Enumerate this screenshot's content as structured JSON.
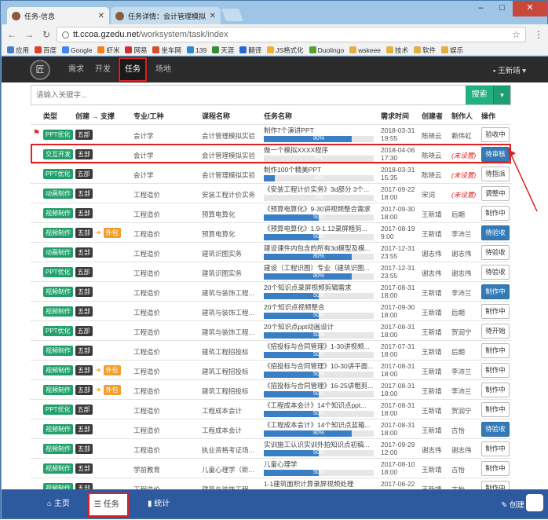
{
  "browser": {
    "tabs": [
      {
        "title": "任务-信息",
        "active": true
      },
      {
        "title": "任务详情：会计管理模拟...",
        "active": false
      }
    ],
    "url_host": "tt.ccoa.gzedu.net",
    "url_path": "/worksystem/task/index",
    "bookmarks": [
      "应用",
      "百度",
      "Google",
      "虾米",
      "网易",
      "坐车网",
      "139",
      "天涯",
      "翻译",
      "JS格式化",
      "Duolingo",
      "wskeee",
      "技术",
      "软件",
      "娱乐"
    ]
  },
  "appnav": {
    "logo_text": "匠",
    "items": [
      "需求",
      "开发",
      "任务",
      "场地"
    ],
    "active": "任务",
    "user": "王新靖"
  },
  "search": {
    "placeholder": "请输入关键字...",
    "button": "搜索"
  },
  "columns": {
    "type": "类型",
    "create_support": "创建 → 支撑",
    "major": "专业/工种",
    "course": "课程名称",
    "task": "任务名称",
    "time": "需求时间",
    "creator": "创建者",
    "maker": "制作人",
    "op": "操作"
  },
  "rows": [
    {
      "flag": true,
      "type": "PPT优化",
      "dept": "五部",
      "support": "",
      "major": "会计学",
      "course": "会计管理模拟实验",
      "task": "制作7个演讲PPT",
      "progress": "80%",
      "date": "2018-03-31",
      "time": "19:55",
      "creator": "陈晓云",
      "maker": "赖伟虹",
      "maker_unset": false,
      "op": "验收中",
      "op_primary": false
    },
    {
      "flag": false,
      "type": "交互开发",
      "dept": "五部",
      "support": "",
      "major": "会计学",
      "course": "会计管理模拟实验",
      "task": "做一个模拟XXXX程序",
      "progress": "0%",
      "date": "2018-04-06",
      "time": "17:30",
      "creator": "陈晓云",
      "maker": "(未设置)",
      "maker_unset": true,
      "op": "待审核",
      "op_primary": true,
      "highlight": true
    },
    {
      "flag": false,
      "type": "PPT优化",
      "dept": "五部",
      "support": "",
      "major": "会计学",
      "course": "会计管理模拟实验",
      "task": "制作100个精美PPT",
      "progress": "10%",
      "date": "2018-03-31",
      "time": "15:35",
      "creator": "陈晓云",
      "maker": "(未设置)",
      "maker_unset": true,
      "op": "待指派",
      "op_primary": false
    },
    {
      "flag": false,
      "type": "动画制作",
      "dept": "五部",
      "support": "",
      "major": "工程造价",
      "course": "安装工程计价实务",
      "task": "《安装工程计价实务》3d部分 3个...",
      "progress": "0%",
      "date": "2017-09-22",
      "time": "18:00",
      "creator": "宋词",
      "maker": "(未设置)",
      "maker_unset": true,
      "op": "调整中",
      "op_primary": false
    },
    {
      "flag": false,
      "type": "视频制作",
      "dept": "五部",
      "support": "",
      "major": "工程造价",
      "course": "预算电算化",
      "task": "《预算电算化》9-30讲视频整合需求",
      "progress": "50%",
      "date": "2017-09-30",
      "time": "18:00",
      "creator": "王新靖",
      "maker": "后期",
      "maker_unset": false,
      "op": "制作中",
      "op_primary": false
    },
    {
      "flag": false,
      "type": "视频制作",
      "dept": "五部",
      "support": "外包",
      "major": "工程造价",
      "course": "预算电算化",
      "task": "《预算电算化》1.9-1.12录屏粗剪...",
      "progress": "50%",
      "date": "2017-08-19",
      "time": "9:00",
      "creator": "王新靖",
      "maker": "李沛兰",
      "maker_unset": false,
      "op": "待验收",
      "op_primary": true
    },
    {
      "flag": false,
      "type": "动画制作",
      "dept": "五部",
      "support": "",
      "major": "工程造价",
      "course": "建筑识图实务",
      "task": "建设课件内包含的所有3d模型及模...",
      "progress": "80%",
      "date": "2017-12-31",
      "time": "23:55",
      "creator": "谢志伟",
      "maker": "谢志伟",
      "maker_unset": false,
      "op": "待验收",
      "op_primary": false
    },
    {
      "flag": false,
      "type": "PPT优化",
      "dept": "五部",
      "support": "",
      "major": "工程造价",
      "course": "建筑识图实务",
      "task": "建设（工程识图）专业（建筑识图...",
      "progress": "80%",
      "date": "2017-12-31",
      "time": "23:55",
      "creator": "谢志伟",
      "maker": "谢志伟",
      "maker_unset": false,
      "op": "待验收",
      "op_primary": false
    },
    {
      "flag": false,
      "type": "视频制作",
      "dept": "五部",
      "support": "",
      "major": "工程造价",
      "course": "建筑与装饰工程...",
      "task": "20个知识点录屏视频剪辑需求",
      "progress": "50%",
      "date": "2017-08-31",
      "time": "18:00",
      "creator": "王新靖",
      "maker": "李沛兰",
      "maker_unset": false,
      "op": "制作中",
      "op_primary": true
    },
    {
      "flag": false,
      "type": "视频制作",
      "dept": "五部",
      "support": "",
      "major": "工程造价",
      "course": "建筑与装饰工程...",
      "task": "20个知识点视频整合",
      "progress": "50%",
      "date": "2017-09-30",
      "time": "18:00",
      "creator": "王新靖",
      "maker": "后期",
      "maker_unset": false,
      "op": "制作中",
      "op_primary": false
    },
    {
      "flag": false,
      "type": "PPT优化",
      "dept": "五部",
      "support": "",
      "major": "工程造价",
      "course": "建筑与装饰工程...",
      "task": "20个知识点ppt动画设计",
      "progress": "50%",
      "date": "2017-08-31",
      "time": "18:00",
      "creator": "王新靖",
      "maker": "贺润宁",
      "maker_unset": false,
      "op": "待开始",
      "op_primary": false
    },
    {
      "flag": false,
      "type": "视频制作",
      "dept": "五部",
      "support": "",
      "major": "工程造价",
      "course": "建筑工程招投标",
      "task": "《招投标与合同管理》1-30讲视频...",
      "progress": "50%",
      "date": "2017-07-31",
      "time": "18:00",
      "creator": "王新靖",
      "maker": "后期",
      "maker_unset": false,
      "op": "制作中",
      "op_primary": false
    },
    {
      "flag": false,
      "type": "视频制作",
      "dept": "五部",
      "support": "外包",
      "major": "工程造价",
      "course": "建筑工程招投标",
      "task": "《招投标与合同管理》10-30讲平面...",
      "progress": "50%",
      "date": "2017-08-31",
      "time": "18:00",
      "creator": "王新靖",
      "maker": "李沛兰",
      "maker_unset": false,
      "op": "制作中",
      "op_primary": false
    },
    {
      "flag": false,
      "type": "视频制作",
      "dept": "五部",
      "support": "外包",
      "major": "工程造价",
      "course": "建筑工程招投标",
      "task": "《招投标与合同管理》16-25讲粗剪...",
      "progress": "50%",
      "date": "2017-08-31",
      "time": "18:00",
      "creator": "王新靖",
      "maker": "李沛兰",
      "maker_unset": false,
      "op": "制作中",
      "op_primary": false
    },
    {
      "flag": false,
      "type": "PPT优化",
      "dept": "五部",
      "support": "",
      "major": "工程造价",
      "course": "工程成本会计",
      "task": "《工程成本会计》14个知识点ppt...",
      "progress": "50%",
      "date": "2017-08-31",
      "time": "18:00",
      "creator": "王新靖",
      "maker": "贺润宁",
      "maker_unset": false,
      "op": "制作中",
      "op_primary": false
    },
    {
      "flag": false,
      "type": "视频制作",
      "dept": "五部",
      "support": "",
      "major": "工程造价",
      "course": "工程成本会计",
      "task": "《工程成本会计》14个知识点蓝箱...",
      "progress": "80%",
      "date": "2017-08-31",
      "time": "18:00",
      "creator": "王新靖",
      "maker": "古怡",
      "maker_unset": false,
      "op": "待验收",
      "op_primary": true
    },
    {
      "flag": false,
      "type": "视频制作",
      "dept": "五部",
      "support": "",
      "major": "工程造价",
      "course": "执业资格考证场...",
      "task": "实训施工认识实训外拍知识点初稿...",
      "progress": "50%",
      "date": "2017-09-29",
      "time": "12:00",
      "creator": "谢志伟",
      "maker": "谢志伟",
      "maker_unset": false,
      "op": "制作中",
      "op_primary": false
    },
    {
      "flag": false,
      "type": "视频制作",
      "dept": "五部",
      "support": "",
      "major": "学前教育",
      "course": "儿童心理学（新...",
      "task": "儿童心理学",
      "progress": "50%",
      "date": "2017-08-10",
      "time": "18:00",
      "creator": "王新靖",
      "maker": "古怡",
      "maker_unset": false,
      "op": "制作中",
      "op_primary": false
    },
    {
      "flag": false,
      "type": "视频制作",
      "dept": "五部",
      "support": "",
      "major": "工程造价",
      "course": "建筑与装饰工程...",
      "task": "1-1建筑面积计算录屏视频处理",
      "progress": "50%",
      "date": "2017-06-22",
      "time": "",
      "creator": "王新靖",
      "maker": "古怡",
      "maker_unset": false,
      "op": "制作中",
      "op_primary": false
    }
  ],
  "bottombar": {
    "home": "主页",
    "task": "任务",
    "stats": "统计",
    "create": "创建"
  },
  "colors": {
    "accent_green": "#21a06a",
    "primary_blue": "#337ab7",
    "nav_dark": "#2b2b2b",
    "bottom_blue": "#2d5a9e",
    "highlight_red": "#e02020"
  }
}
